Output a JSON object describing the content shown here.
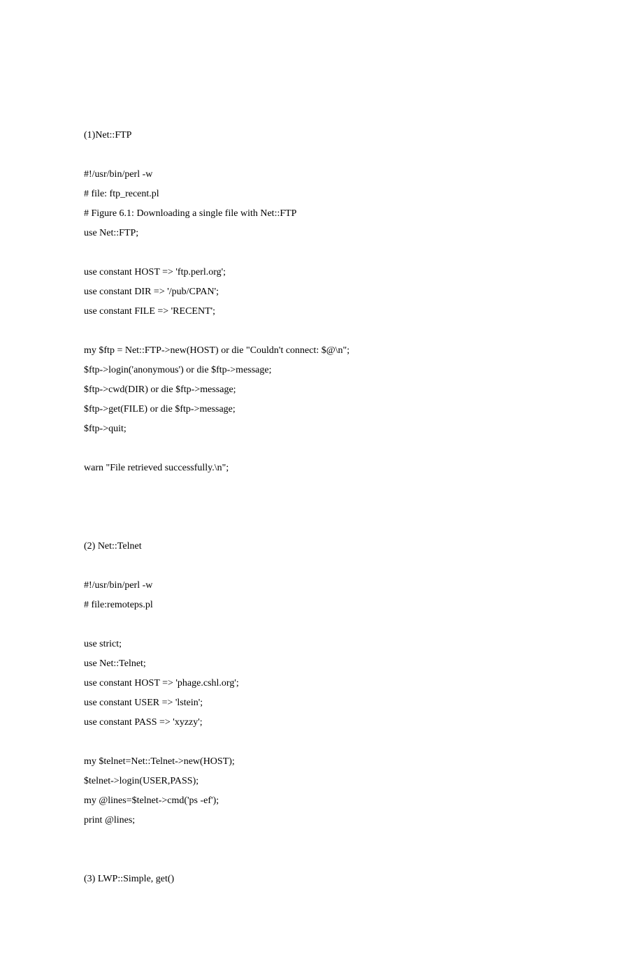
{
  "lines": [
    "(1)Net::FTP",
    "",
    "#!/usr/bin/perl -w",
    "# file: ftp_recent.pl",
    "# Figure 6.1: Downloading a single file with Net::FTP",
    "use Net::FTP;",
    "",
    "use constant HOST => 'ftp.perl.org';",
    "use constant DIR => '/pub/CPAN';",
    "use constant FILE => 'RECENT';",
    "",
    "my $ftp = Net::FTP->new(HOST) or die \"Couldn't connect: $@\\n\";",
    "$ftp->login('anonymous') or die $ftp->message;",
    "$ftp->cwd(DIR) or die $ftp->message;",
    "$ftp->get(FILE) or die $ftp->message;",
    "$ftp->quit;",
    "",
    "warn \"File retrieved successfully.\\n\";",
    "",
    "",
    "",
    "(2) Net::Telnet",
    "",
    "#!/usr/bin/perl -w",
    "# file:remoteps.pl",
    "",
    "use strict;",
    "use Net::Telnet;",
    "use constant HOST => 'phage.cshl.org';",
    "use constant USER => 'lstein';",
    "use constant PASS => 'xyzzy';",
    "",
    "my $telnet=Net::Telnet->new(HOST);",
    "$telnet->login(USER,PASS);",
    "my @lines=$telnet->cmd('ps -ef');",
    "print @lines;",
    "",
    "",
    "(3) LWP::Simple, get()"
  ]
}
